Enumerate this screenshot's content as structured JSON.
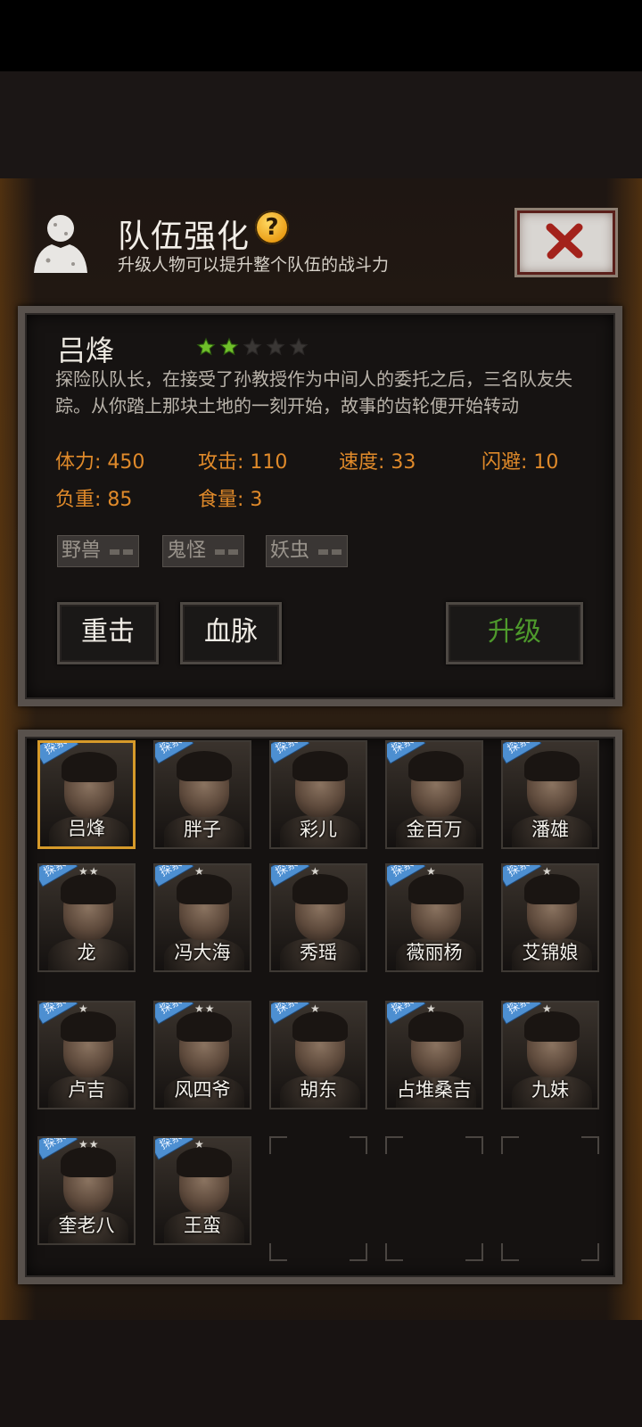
{
  "header": {
    "title": "队伍强化",
    "help": "?",
    "subtitle": "升级人物可以提升整个队伍的战斗力"
  },
  "selected": {
    "name": "吕烽",
    "stars_filled": 2,
    "stars_total": 5,
    "description": "探险队队长，在接受了孙教授作为中间人的委托之后，三名队友失踪。从你踏上那块土地的一刻开始，故事的齿轮便开始转动",
    "stats": {
      "hp": "体力: 450",
      "attack": "攻击: 110",
      "speed": "速度: 33",
      "dodge": "闪避: 10",
      "load": "负重: 85",
      "food": "食量: 3"
    },
    "tags": [
      "野兽",
      "鬼怪",
      "妖虫"
    ],
    "buttons": {
      "heavy_strike": "重击",
      "bloodline": "血脉",
      "upgrade": "升级"
    }
  },
  "explore_badge": "探索",
  "roster": [
    {
      "name": "吕烽",
      "explore": true,
      "stars": ""
    },
    {
      "name": "胖子",
      "explore": true,
      "stars": ""
    },
    {
      "name": "彩儿",
      "explore": true,
      "stars": ""
    },
    {
      "name": "金百万",
      "explore": true,
      "stars": ""
    },
    {
      "name": "潘雄",
      "explore": true,
      "stars": ""
    },
    {
      "name": "龙",
      "explore": true,
      "stars": "★★"
    },
    {
      "name": "冯大海",
      "explore": true,
      "stars": "★"
    },
    {
      "name": "秀瑶",
      "explore": true,
      "stars": "★"
    },
    {
      "name": "薇丽杨",
      "explore": true,
      "stars": "★"
    },
    {
      "name": "艾锦娘",
      "explore": true,
      "stars": "★"
    },
    {
      "name": "卢吉",
      "explore": true,
      "stars": "★"
    },
    {
      "name": "风四爷",
      "explore": true,
      "stars": "★★"
    },
    {
      "name": "胡东",
      "explore": true,
      "stars": "★"
    },
    {
      "name": "占堆桑吉",
      "explore": true,
      "stars": "★"
    },
    {
      "name": "九妹",
      "explore": true,
      "stars": "★"
    },
    {
      "name": "奎老八",
      "explore": true,
      "stars": "★★"
    },
    {
      "name": "王蛮",
      "explore": true,
      "stars": "★"
    }
  ],
  "colors": {
    "stat_orange": "#e08a2a",
    "upgrade_green": "#4e9a2c",
    "star_green": "#6fbf2a",
    "selected_border": "#d69a2a",
    "explore_blue": "#4d8fd1"
  }
}
